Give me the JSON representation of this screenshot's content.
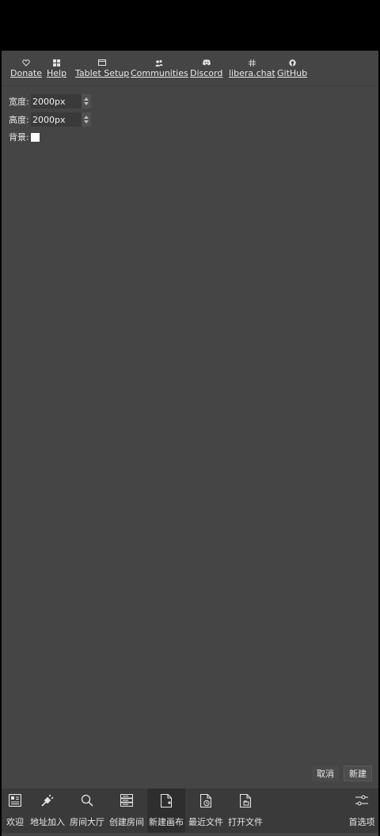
{
  "links": [
    {
      "label": "Donate",
      "icon": "heart-icon"
    },
    {
      "label": "Help",
      "icon": "help-grid-icon"
    },
    {
      "label": "Tablet Setup",
      "icon": "tablet-icon"
    },
    {
      "label": "Communities",
      "icon": "people-icon"
    },
    {
      "label": "Discord",
      "icon": "discord-icon"
    },
    {
      "label": "libera.chat",
      "icon": "hash-icon"
    },
    {
      "label": "GitHub",
      "icon": "github-icon"
    }
  ],
  "form": {
    "width_label": "宽度:",
    "width_value": "2000px",
    "height_label": "高度:",
    "height_value": "2000px",
    "background_label": "背景:",
    "background_color": "#ffffff"
  },
  "dialog": {
    "cancel_label": "取消",
    "create_label": "新建"
  },
  "toolbar": [
    {
      "label": "欢迎",
      "icon": "welcome-icon"
    },
    {
      "label": "地址加入",
      "icon": "plug-icon"
    },
    {
      "label": "房间大厅",
      "icon": "search-icon"
    },
    {
      "label": "创建房间",
      "icon": "server-icon"
    },
    {
      "label": "新建画布",
      "icon": "new-document-icon",
      "active": true
    },
    {
      "label": "最近文件",
      "icon": "recent-file-icon"
    },
    {
      "label": "打开文件",
      "icon": "open-file-icon"
    },
    {
      "label": "首选项",
      "icon": "preferences-icon"
    }
  ],
  "colors": {
    "window_bg": "#454545",
    "toolbar_bg": "#3a3a3a",
    "text": "#e6e6e6"
  }
}
